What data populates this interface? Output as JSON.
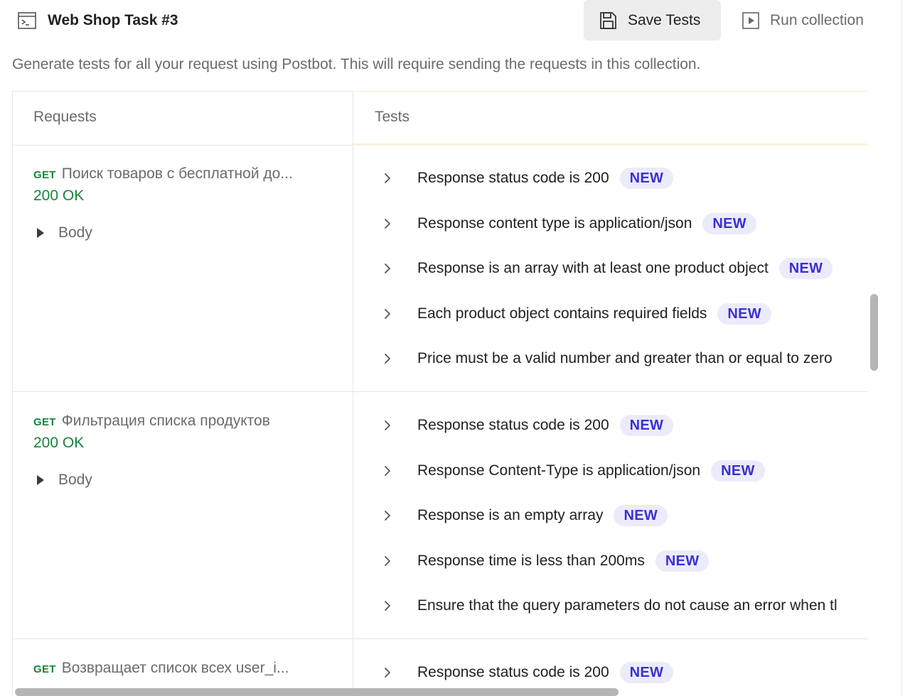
{
  "header": {
    "title": "Web Shop Task #3",
    "save_label": "Save Tests",
    "run_label": "Run collection"
  },
  "description": "Generate tests for all your request using Postbot. This will require sending the requests in this collection.",
  "table": {
    "col_requests": "Requests",
    "col_tests": "Tests",
    "rows": [
      {
        "method": "GET",
        "name": "Поиск товаров с бесплатной до...",
        "status": "200 OK",
        "body_label": "Body",
        "tests": [
          {
            "text": "Response status code is 200",
            "badge": "NEW"
          },
          {
            "text": "Response content type is application/json",
            "badge": "NEW"
          },
          {
            "text": "Response is an array with at least one product object",
            "badge": "NEW"
          },
          {
            "text": "Each product object contains required fields",
            "badge": "NEW"
          },
          {
            "text": "Price must be a valid number and greater than or equal to zero",
            "badge": ""
          }
        ]
      },
      {
        "method": "GET",
        "name": "Фильтрация списка продуктов",
        "status": "200 OK",
        "body_label": "Body",
        "tests": [
          {
            "text": "Response status code is 200",
            "badge": "NEW"
          },
          {
            "text": "Response Content-Type is application/json",
            "badge": "NEW"
          },
          {
            "text": "Response is an empty array",
            "badge": "NEW"
          },
          {
            "text": "Response time is less than 200ms",
            "badge": "NEW"
          },
          {
            "text": "Ensure that the query parameters do not cause an error when tl",
            "badge": ""
          }
        ]
      },
      {
        "method": "GET",
        "name": "Возвращает список всех user_i...",
        "status": "",
        "body_label": "",
        "tests": [
          {
            "text": "Response status code is 200",
            "badge": "NEW"
          }
        ]
      }
    ]
  },
  "colors": {
    "accent_badge_text": "#3b2fd4",
    "accent_badge_bg": "#ecebfb",
    "status_ok": "#16843a"
  },
  "icons": {
    "collection": "terminal-window-icon",
    "save": "floppy-disk-icon",
    "run": "play-box-icon",
    "chevron": "chevron-right-icon",
    "expand": "triangle-right-icon"
  }
}
